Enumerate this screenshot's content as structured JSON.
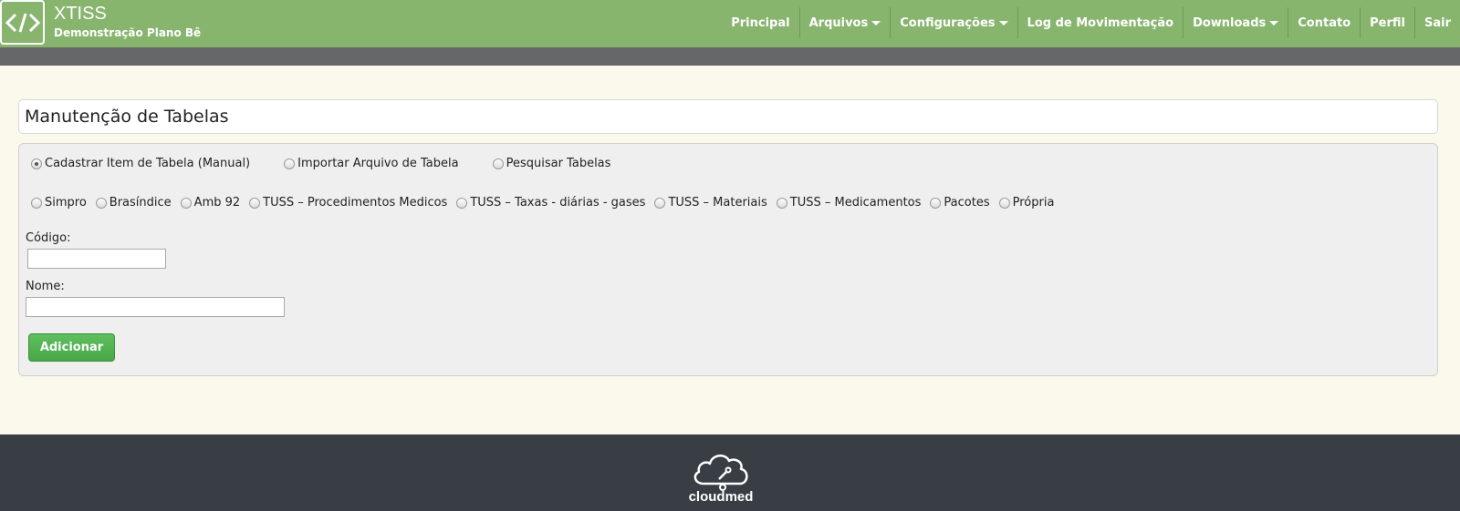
{
  "header": {
    "logo_symbol": "</>",
    "title": "XTISS",
    "subtitle": "Demonstração Plano Bê",
    "colors": {
      "bar": "#87b56e",
      "subbar": "#666769"
    },
    "nav": [
      {
        "label": "Principal",
        "dropdown": false
      },
      {
        "label": "Arquivos",
        "dropdown": true
      },
      {
        "label": "Configurações",
        "dropdown": true
      },
      {
        "label": "Log de Movimentação",
        "dropdown": false
      },
      {
        "label": "Downloads",
        "dropdown": true
      },
      {
        "label": "Contato",
        "dropdown": false
      },
      {
        "label": "Perfil",
        "dropdown": false
      },
      {
        "label": "Sair",
        "dropdown": false
      }
    ]
  },
  "page": {
    "title": "Manutenção de Tabelas"
  },
  "form": {
    "mode_options": [
      {
        "label": "Cadastrar Item de Tabela (Manual)",
        "checked": true
      },
      {
        "label": "Importar Arquivo de Tabela",
        "checked": false
      },
      {
        "label": "Pesquisar Tabelas",
        "checked": false
      }
    ],
    "table_options": [
      {
        "label": "Simpro",
        "checked": false
      },
      {
        "label": "Brasíndice",
        "checked": false
      },
      {
        "label": "Amb 92",
        "checked": false
      },
      {
        "label": "TUSS – Procedimentos Medicos",
        "checked": false
      },
      {
        "label": "TUSS – Taxas - diárias - gases",
        "checked": false
      },
      {
        "label": "TUSS – Materiais",
        "checked": false
      },
      {
        "label": "TUSS – Medicamentos",
        "checked": false
      },
      {
        "label": "Pacotes",
        "checked": false
      },
      {
        "label": "Própria",
        "checked": false
      }
    ],
    "codigo_label": "Código:",
    "codigo_value": "",
    "nome_label": "Nome:",
    "nome_value": "",
    "add_button_label": "Adicionar",
    "button_color": "#4cae4c"
  },
  "footer": {
    "brand": "cloudmed",
    "logo_icon": "cloud-stethoscope-icon",
    "background": "#393d44"
  }
}
